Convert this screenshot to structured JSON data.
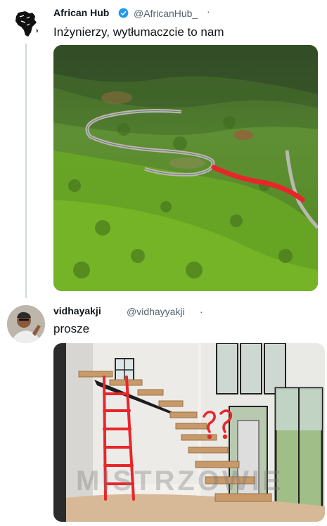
{
  "tweets": [
    {
      "author_name": "African Hub",
      "handle": "@AfricanHub_",
      "more": "·",
      "text": "Inżynierzy, wytłumaczcie to nam",
      "avatar_icon": "africa-map-icon",
      "verified_icon": "verified-badge-icon",
      "media_icon": "aerial-photo-winding-road"
    },
    {
      "author_name": "vidhayakji",
      "handle": "@vidhayyakji",
      "more": "·",
      "text": "prosze",
      "avatar_icon": "man-portrait-avatar",
      "media_icon": "photo-floating-staircase-with-red-ladder"
    }
  ],
  "watermark": "MISTRZOWIE",
  "colors": {
    "accent": "#1d9bf0",
    "secondary_text": "#536471",
    "annotation_red": "#e8262a"
  }
}
